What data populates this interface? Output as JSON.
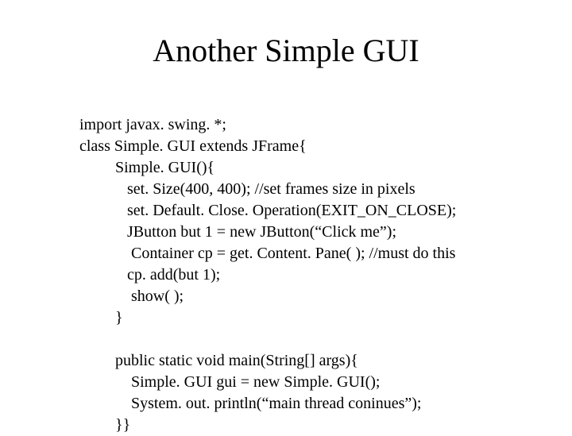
{
  "title": "Another Simple GUI",
  "code": {
    "l1": "import javax. swing. *;",
    "l2": "class Simple. GUI extends JFrame{",
    "l3": "         Simple. GUI(){",
    "l4": "            set. Size(400, 400); //set frames size in pixels",
    "l5": "            set. Default. Close. Operation(EXIT_ON_CLOSE);",
    "l6": "            JButton but 1 = new JButton(“Click me”);",
    "l7": "             Container cp = get. Content. Pane( ); //must do this",
    "l8": "            cp. add(but 1);",
    "l9": "             show( );",
    "l10": "         }",
    "l11": "",
    "l12": "         public static void main(String[] args){",
    "l13": "             Simple. GUI gui = new Simple. GUI();",
    "l14": "             System. out. println(“main thread coninues”);",
    "l15": "         }}"
  }
}
